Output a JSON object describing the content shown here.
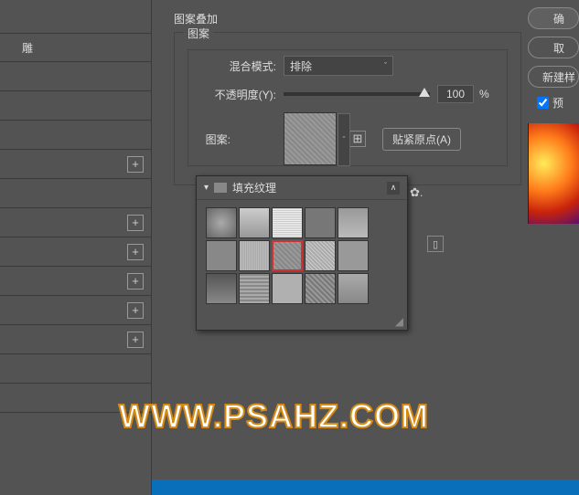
{
  "fx_panel": {
    "title": "图案叠加",
    "subgroup": "图案",
    "blend_mode_label": "混合模式:",
    "blend_mode_value": "排除",
    "opacity_label": "不透明度(Y):",
    "opacity_value": "100",
    "opacity_unit": "%",
    "pattern_label": "图案:",
    "snap_origin": "贴紧原点(A)"
  },
  "left_list": {
    "item_label": "雕"
  },
  "pattern_picker": {
    "group_name": "填充纹理"
  },
  "right": {
    "ok": "确",
    "cancel": "取",
    "new_style": "新建样",
    "preview": "预"
  },
  "watermark": "WWW.PSAHZ.COM"
}
